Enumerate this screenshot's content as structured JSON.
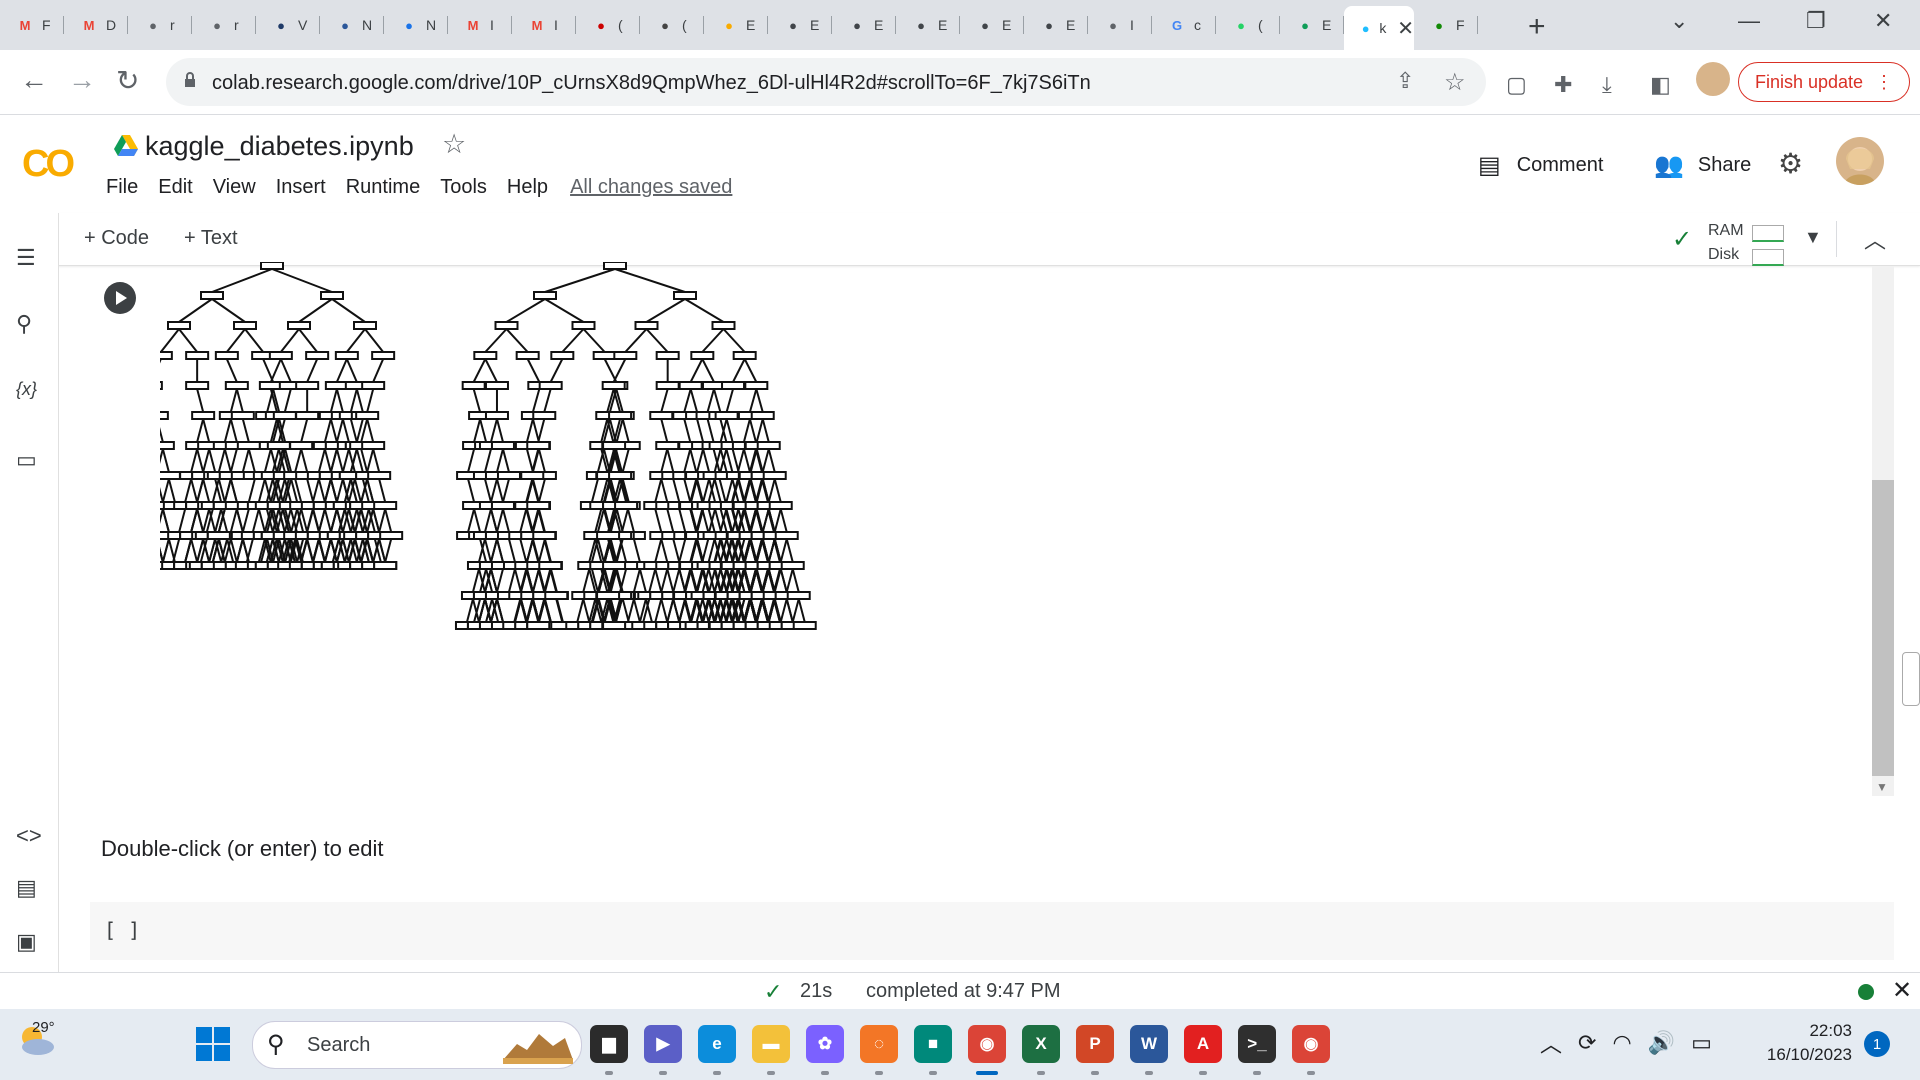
{
  "browser": {
    "tabs": [
      {
        "icon": "gmail-icon",
        "title": "F"
      },
      {
        "icon": "gmail-icon",
        "title": "D"
      },
      {
        "icon": "globe-icon",
        "title": "r"
      },
      {
        "icon": "globe-icon",
        "title": "r"
      },
      {
        "icon": "wiley-icon",
        "title": "V"
      },
      {
        "icon": "word-icon",
        "title": "N"
      },
      {
        "icon": "mendeley-icon",
        "title": "N"
      },
      {
        "icon": "gmail-icon",
        "title": "I"
      },
      {
        "icon": "gmail-icon",
        "title": "I"
      },
      {
        "icon": "pub-icon",
        "title": "("
      },
      {
        "icon": "researchgate-icon",
        "title": "("
      },
      {
        "icon": "colab-icon",
        "title": "E"
      },
      {
        "icon": "academia-icon",
        "title": "E"
      },
      {
        "icon": "academia-icon",
        "title": "E"
      },
      {
        "icon": "academia-icon",
        "title": "E"
      },
      {
        "icon": "academia-icon",
        "title": "E"
      },
      {
        "icon": "academia-icon",
        "title": "E"
      },
      {
        "icon": "globe-icon",
        "title": "I"
      },
      {
        "icon": "google-icon",
        "title": "c"
      },
      {
        "icon": "whatsapp-icon",
        "title": "("
      },
      {
        "icon": "drive-icon",
        "title": "E"
      },
      {
        "icon": "kaggle-icon",
        "title": "k",
        "active": true
      },
      {
        "icon": "overleaf-icon",
        "title": "F"
      }
    ],
    "url": "colab.research.google.com/drive/10P_cUrnsX8d9QmpWhez_6Dl-ulHl4R2d#scrollTo=6F_7kj7S6iTn",
    "finish_update": "Finish update"
  },
  "colab": {
    "logo": "CO",
    "notebook_title": "kaggle_diabetes.ipynb",
    "menu": [
      "File",
      "Edit",
      "View",
      "Insert",
      "Runtime",
      "Tools",
      "Help"
    ],
    "saved_status": "All changes saved",
    "comment": "Comment",
    "share": "Share",
    "add_code": "+ Code",
    "add_text": "+ Text",
    "ram_label": "RAM",
    "disk_label": "Disk",
    "text_cell": "Double-click (or enter) to edit",
    "code_cell_prompt": "[ ]",
    "status": {
      "duration": "21s",
      "completed": "completed at 9:47 PM"
    }
  },
  "taskbar": {
    "temperature": "29°",
    "search_placeholder": "Search",
    "time": "22:03",
    "date": "16/10/2023",
    "notifications": "1",
    "apps": [
      {
        "name": "task-view",
        "color": "#2b2b2b",
        "glyph": "▆"
      },
      {
        "name": "teams",
        "color": "#5b5fc7",
        "glyph": "▶"
      },
      {
        "name": "edge",
        "color": "#0c8ddb",
        "glyph": "e"
      },
      {
        "name": "file-explorer",
        "color": "#f3c13a",
        "glyph": "▬"
      },
      {
        "name": "copilot",
        "color": "#7b61ff",
        "glyph": "✿"
      },
      {
        "name": "jupyter",
        "color": "#f37626",
        "glyph": "◌"
      },
      {
        "name": "meet",
        "color": "#00897b",
        "glyph": "■"
      },
      {
        "name": "chrome",
        "color": "#db4437",
        "glyph": "◉",
        "active": true
      },
      {
        "name": "excel",
        "color": "#1d6f42",
        "glyph": "X"
      },
      {
        "name": "powerpoint",
        "color": "#d24726",
        "glyph": "P"
      },
      {
        "name": "word",
        "color": "#2b579a",
        "glyph": "W"
      },
      {
        "name": "acrobat",
        "color": "#e22020",
        "glyph": "A"
      },
      {
        "name": "terminal",
        "color": "#2f2f2f",
        "glyph": ">_"
      },
      {
        "name": "chrome-profile",
        "color": "#db4437",
        "glyph": "◉"
      }
    ]
  }
}
